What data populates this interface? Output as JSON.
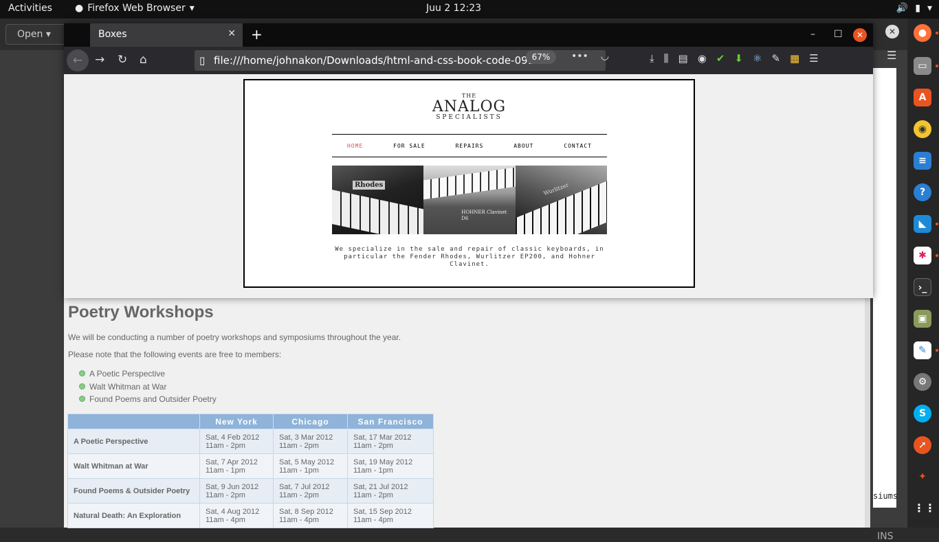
{
  "topbar": {
    "activities": "Activities",
    "app_name": "Firefox Web Browser",
    "clock": "Juu 2  12:23"
  },
  "bg_window": {
    "open_label": "Open",
    "side_text": "siums",
    "ins_label": "INS"
  },
  "firefox": {
    "tab_title": "Boxes",
    "url": "file:///home/johnakon/Downloads/html-and-css-book-code-091",
    "zoom": "67%"
  },
  "analog": {
    "logo_the": "THE",
    "logo_main": "ANALOG",
    "logo_sub": "SPECIALISTS",
    "nav": [
      "HOME",
      "FOR SALE",
      "REPAIRS",
      "ABOUT",
      "CONTACT"
    ],
    "intro": "We specialize in the sale and repair of classic keyboards, in particular the Fender Rhodes, Wurlitzer EP200, and Hohner Clavinet.",
    "pics": [
      "Rhodes",
      "HOHNER Clavinet D6",
      "Wurlitzer"
    ],
    "accent_color": "#d9534f"
  },
  "poetry": {
    "title": "Poetry Workshops",
    "para1": "We will be conducting a number of poetry workshops and symposiums throughout the year.",
    "para2": "Please note that the following events are free to members:",
    "list": [
      "A Poetic Perspective",
      "Walt Whitman at War",
      "Found Poems and Outsider Poetry"
    ],
    "table": {
      "headers": [
        "",
        "New York",
        "Chicago",
        "San Francisco"
      ],
      "rows": [
        {
          "name": "A Poetic Perspective",
          "ny": [
            "Sat, 4 Feb 2012",
            "11am - 2pm"
          ],
          "chi": [
            "Sat, 3 Mar 2012",
            "11am - 2pm"
          ],
          "sf": [
            "Sat, 17 Mar 2012",
            "11am - 2pm"
          ]
        },
        {
          "name": "Walt Whitman at War",
          "ny": [
            "Sat, 7 Apr 2012",
            "11am - 1pm"
          ],
          "chi": [
            "Sat, 5 May 2012",
            "11am - 1pm"
          ],
          "sf": [
            "Sat, 19 May 2012",
            "11am - 1pm"
          ]
        },
        {
          "name": "Found Poems & Outsider Poetry",
          "ny": [
            "Sat, 9 Jun 2012",
            "11am - 2pm"
          ],
          "chi": [
            "Sat, 7 Jul 2012",
            "11am - 2pm"
          ],
          "sf": [
            "Sat, 21 Jul 2012",
            "11am - 2pm"
          ]
        },
        {
          "name": "Natural Death: An Exploration",
          "ny": [
            "Sat, 4 Aug 2012",
            "11am - 4pm"
          ],
          "chi": [
            "Sat, 8 Sep 2012",
            "11am - 4pm"
          ],
          "sf": [
            "Sat, 15 Sep 2012",
            "11am - 4pm"
          ]
        }
      ]
    }
  },
  "dock": {
    "icons": [
      "firefox-icon",
      "files-icon",
      "software-icon",
      "rhythmbox-icon",
      "writer-icon",
      "help-icon",
      "vscode-icon",
      "slack-icon",
      "terminal-icon",
      "archive-icon",
      "text-editor-icon",
      "settings-icon",
      "skype-icon",
      "compass-icon",
      "figma-icon",
      "app-grid-icon"
    ]
  }
}
